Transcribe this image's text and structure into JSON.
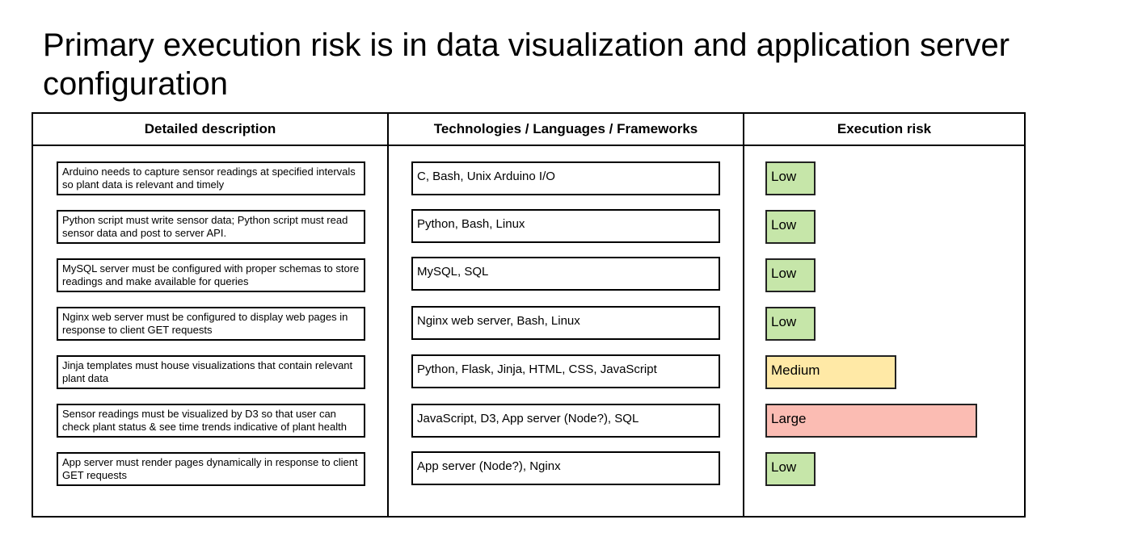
{
  "title": "Primary execution risk is in data visualization and application server configuration",
  "headers": {
    "description": "Detailed description",
    "technologies": "Technologies / Languages / Frameworks",
    "risk": "Execution risk"
  },
  "rows": [
    {
      "description": "Arduino needs to capture sensor readings at specified intervals so plant data is relevant and timely",
      "technologies": "C, Bash, Unix Arduino I/O",
      "risk": "Low"
    },
    {
      "description": "Python script must write sensor data; Python script must read sensor data and post to server API.",
      "technologies": "Python, Bash, Linux",
      "risk": "Low"
    },
    {
      "description": "MySQL server must be configured with proper schemas to store readings and make available for queries",
      "technologies": "MySQL, SQL",
      "risk": "Low"
    },
    {
      "description": "Nginx web server must be configured to display web pages in response to client GET requests",
      "technologies": "Nginx web server, Bash, Linux",
      "risk": "Low"
    },
    {
      "description": "Jinja templates must house visualizations that contain relevant plant data",
      "technologies": "Python, Flask, Jinja, HTML, CSS, JavaScript",
      "risk": "Medium"
    },
    {
      "description": "Sensor readings must be visualized by D3 so that user can check plant status & see time trends indicative of plant health",
      "technologies": "JavaScript, D3, App server (Node?), SQL",
      "risk": "Large"
    },
    {
      "description": "App server must render pages dynamically in response to client GET requests",
      "technologies": "App server (Node?), Nginx",
      "risk": "Low"
    }
  ],
  "colors": {
    "low": "#c6e6a9",
    "medium": "#ffe9a6",
    "large": "#fbbcb3"
  }
}
